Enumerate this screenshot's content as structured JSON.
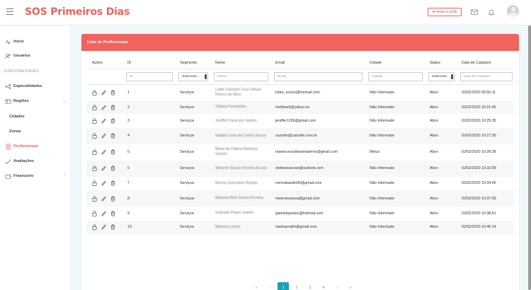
{
  "app": {
    "brand": "SOS Primeiros Dias"
  },
  "header": {
    "site_button": "IR PARA O SITE",
    "icons": [
      "menu-icon",
      "mail-icon",
      "bell-icon",
      "avatar"
    ]
  },
  "sidebar": {
    "section_header": "FUNCIONALIDADES",
    "items": [
      {
        "label": "Início",
        "icon": "pulse-icon"
      },
      {
        "label": "Usuários",
        "icon": "users-icon"
      },
      {
        "label": "Especialidades",
        "icon": "git-icon"
      },
      {
        "label": "Regiões",
        "icon": "map-icon"
      },
      {
        "label": "Cidades",
        "icon": ""
      },
      {
        "label": "Zonas",
        "icon": ""
      },
      {
        "label": "Profissionais",
        "icon": "profile-icon"
      },
      {
        "label": "Avaliações",
        "icon": "check-icon"
      },
      {
        "label": "Financeiro",
        "icon": "wallet-icon"
      }
    ]
  },
  "card": {
    "title": "Lista de Profissionais"
  },
  "table": {
    "columns": [
      "Ações",
      "ID",
      "Segmento",
      "Nome",
      "Email",
      "Cidade",
      "Status",
      "Data de Cadastro"
    ],
    "filters": {
      "id": "ID",
      "segmento": "Selecione...",
      "nome": "Nome",
      "email": "Email",
      "cidade": "Cidade",
      "status": "Selecione",
      "data": "Data de Cadastro"
    },
    "rows": [
      {
        "id": "1",
        "segmento": "Serviços",
        "nome": "Lutter Eduardo Cruz Otazal Ormos da Silva",
        "email": "lutter_ecoos@hotmail.com",
        "cidade": "Não Informado",
        "status": "Ativo",
        "data": "02/02/2020 09:50:11"
      },
      {
        "id": "2",
        "segmento": "Serviços",
        "nome": "Tatiana Fernandes",
        "email": "mellima9@yahoo.es",
        "cidade": "Não Informado",
        "status": "Ativo",
        "data": "02/02/2020 10:21:46"
      },
      {
        "id": "3",
        "segmento": "Serviços",
        "nome": "Jeniffer Faria dos Santos",
        "email": "jeniffer1206@gmail.com",
        "cidade": "Não Informado",
        "status": "Ativo",
        "data": "02/02/2020 10:25:35"
      },
      {
        "id": "4",
        "segmento": "Serviços",
        "nome": "Natália Carla de Castro Souza",
        "email": "cazulim@cazulim.com.br",
        "cidade": "Não Informado",
        "status": "Ativo",
        "data": "02/02/2020 10:27:30"
      },
      {
        "id": "5",
        "segmento": "Serviços",
        "nome": "Maria de Fátima Barbosa Soares",
        "email": "materconsultoriamaterno@gmail.com",
        "cidade": "Ilhéus",
        "status": "Ativo",
        "data": "02/02/2020 10:28:38"
      },
      {
        "id": "6",
        "segmento": "Serviços",
        "nome": "Stefanie Souza Ferreira Acciari",
        "email": "stefanieacciari@outlook.com",
        "cidade": "Não Informado",
        "status": "Ativo",
        "data": "02/02/2020 10:32:09"
      },
      {
        "id": "7",
        "segmento": "Serviços",
        "nome": "Norma Gonçalves Basílio",
        "email": "normabasilio90@gmail.com",
        "cidade": "Não Informado",
        "status": "Ativo",
        "data": "02/02/2020 10:34:00"
      },
      {
        "id": "8",
        "segmento": "Serviços",
        "nome": "Mariana Reis Sousa Ferreira",
        "email": "marireissousa@gmail.com",
        "cidade": "Não Informado",
        "status": "Ativo",
        "data": "02/02/2020 10:37:09"
      },
      {
        "id": "9",
        "segmento": "Serviços",
        "nome": "Gabriela Prates Valério",
        "email": "gabrielaprates@hotmail.com",
        "cidade": "Não Informado",
        "status": "Ativo",
        "data": "02/02/2020 10:38:41"
      },
      {
        "id": "10",
        "segmento": "Serviços",
        "nome": "Mariana Lanna",
        "email": "mariiannabh@gmail.com",
        "cidade": "Não Informado",
        "status": "Ativo",
        "data": "02/02/2020 10:40:14"
      }
    ]
  },
  "pagination": {
    "first": "«",
    "prev": "‹",
    "pages": [
      "1",
      "2",
      "3",
      "4"
    ],
    "next": "›",
    "last": "»",
    "current": "1"
  },
  "colors": {
    "brand": "#f0615c",
    "header_bar": "#f0635e",
    "active_page": "#17a2b8"
  }
}
